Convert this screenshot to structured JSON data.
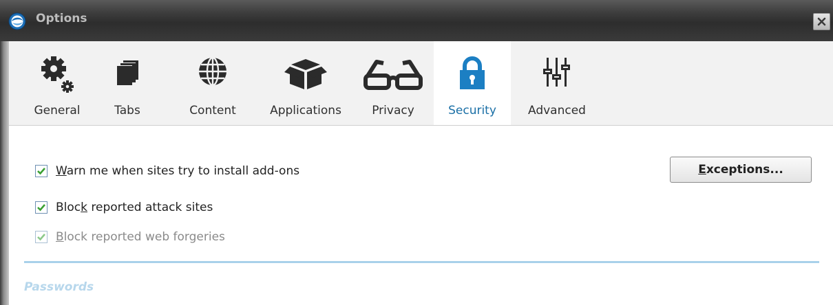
{
  "window": {
    "title": "Options",
    "icons": {
      "app": "browser-logo-icon",
      "close": "close-icon"
    }
  },
  "toolbar": {
    "active": "Security",
    "tabs": [
      {
        "label": "General",
        "icon": "gear-icon"
      },
      {
        "label": "Tabs",
        "icon": "stacked-tabs-icon"
      },
      {
        "label": "Content",
        "icon": "globe-icon"
      },
      {
        "label": "Applications",
        "icon": "box-icon"
      },
      {
        "label": "Privacy",
        "icon": "glasses-icon"
      },
      {
        "label": "Security",
        "icon": "lock-icon"
      },
      {
        "label": "Advanced",
        "icon": "sliders-icon"
      }
    ]
  },
  "security": {
    "warn_addons": {
      "prefix": "",
      "mnemonic": "W",
      "suffix": "arn me when sites try to install add-ons",
      "checked": true
    },
    "exceptions_button": {
      "mnemonic": "E",
      "suffix": "xceptions..."
    },
    "block_attack": {
      "prefix": "Bloc",
      "mnemonic": "k",
      "suffix": " reported attack sites",
      "checked": true
    },
    "block_forgeries": {
      "prefix": "",
      "mnemonic": "B",
      "suffix": "lock reported web forgeries",
      "checked": true,
      "disabled": true
    },
    "passwords_heading": "Passwords"
  },
  "colors": {
    "active_tab_text": "#1a6fa6",
    "accent_blue": "#1c7fc3",
    "divider": "#a8d1ea",
    "check_green": "#3aa033"
  }
}
